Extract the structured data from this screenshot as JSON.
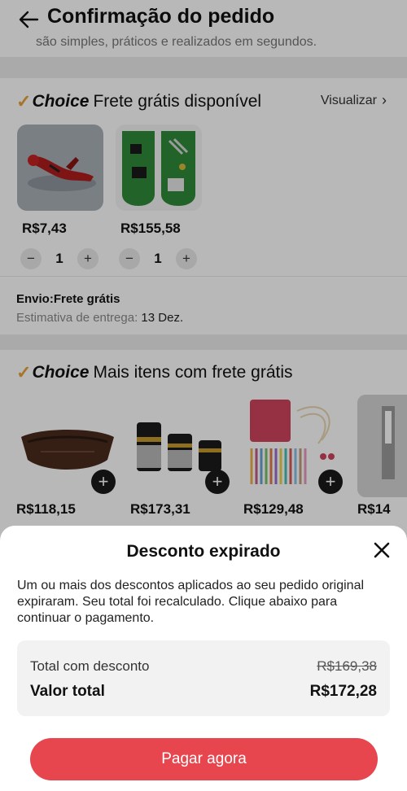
{
  "header": {
    "title": "Confirmação do pedido",
    "clipped_text": "são simples, práticos e realizados em segundos."
  },
  "choice_section": {
    "brand": "Choice",
    "label": "Frete grátis disponível",
    "view_link": "Visualizar",
    "products": [
      {
        "price": "R$7,43",
        "quantity": "1",
        "image": "figurine-red-hero"
      },
      {
        "price": "R$155,58",
        "quantity": "1",
        "image": "green-circuit-boards"
      }
    ],
    "shipping_label": "Envio:Frete grátis",
    "estimate_label": "Estimativa de entrega:",
    "estimate_date": "13 Dez."
  },
  "more_section": {
    "brand": "Choice",
    "label": "Mais itens com frete grátis",
    "items": [
      {
        "price": "R$118,15",
        "image": "leather-waist-bag"
      },
      {
        "price": "R$173,31",
        "image": "black-gold-cylinders"
      },
      {
        "price": "R$129,48",
        "image": "pink-knitting-needle-case"
      },
      {
        "price": "R$14",
        "image": "clipped-product"
      }
    ]
  },
  "modal": {
    "title": "Desconto expirado",
    "message": "Um ou mais dos descontos aplicados ao seu pedido original expiraram. Seu total foi recalculado. Clique abaixo para continuar o pagamento.",
    "discount_label": "Total com desconto",
    "discount_old": "R$169,38",
    "total_label": "Valor total",
    "total_value": "R$172,28",
    "pay_button": "Pagar agora"
  },
  "colors": {
    "accent": "#e8464f",
    "choice_check": "#e8a33a"
  }
}
